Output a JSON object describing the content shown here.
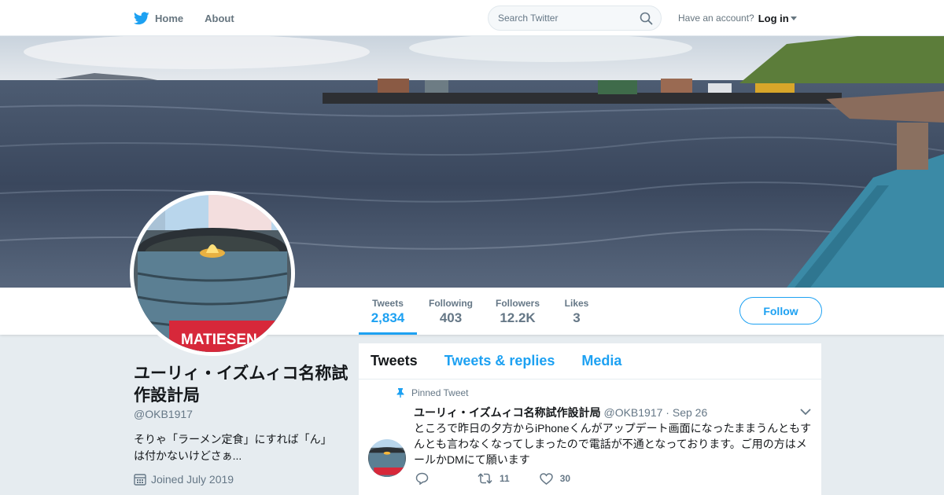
{
  "nav": {
    "home_label": "Home",
    "about_label": "About",
    "search_placeholder": "Search Twitter",
    "have_account": "Have an account?",
    "login_label": "Log in"
  },
  "stats": [
    {
      "label": "Tweets",
      "value": "2,834"
    },
    {
      "label": "Following",
      "value": "403"
    },
    {
      "label": "Followers",
      "value": "12.2K"
    },
    {
      "label": "Likes",
      "value": "3"
    }
  ],
  "follow_label": "Follow",
  "profile": {
    "name": "ユーリィ・イズムィコ名称試作設計局",
    "handle": "@OKB1917",
    "bio": "そりゃ「ラーメン定食」にすれば「ん」は付かないけどさぁ...",
    "joined": "Joined July 2019"
  },
  "avatar_text": "MATIESEN",
  "tabs": [
    "Tweets",
    "Tweets & replies",
    "Media"
  ],
  "tweet": {
    "pinned_label": "Pinned Tweet",
    "name": "ユーリィ・イズムィコ名称試作設計局",
    "handle": "@OKB1917",
    "dot": "·",
    "date": "Sep 26",
    "text": "ところで昨日の夕方からiPhoneくんがアップデート画面になったままうんともすんとも言わなくなってしまったので電話が不通となっております。ご用の方はメールかDMにて願います",
    "retweets": "11",
    "likes": "30"
  },
  "colors": {
    "accent": "#1da1f2",
    "background": "#e6ecf0",
    "muted": "#657786"
  },
  "icons": [
    "twitter-bird-icon",
    "search-icon",
    "calendar-icon",
    "pin-icon",
    "reply-icon",
    "retweet-icon",
    "like-icon",
    "chevron-down-icon"
  ]
}
